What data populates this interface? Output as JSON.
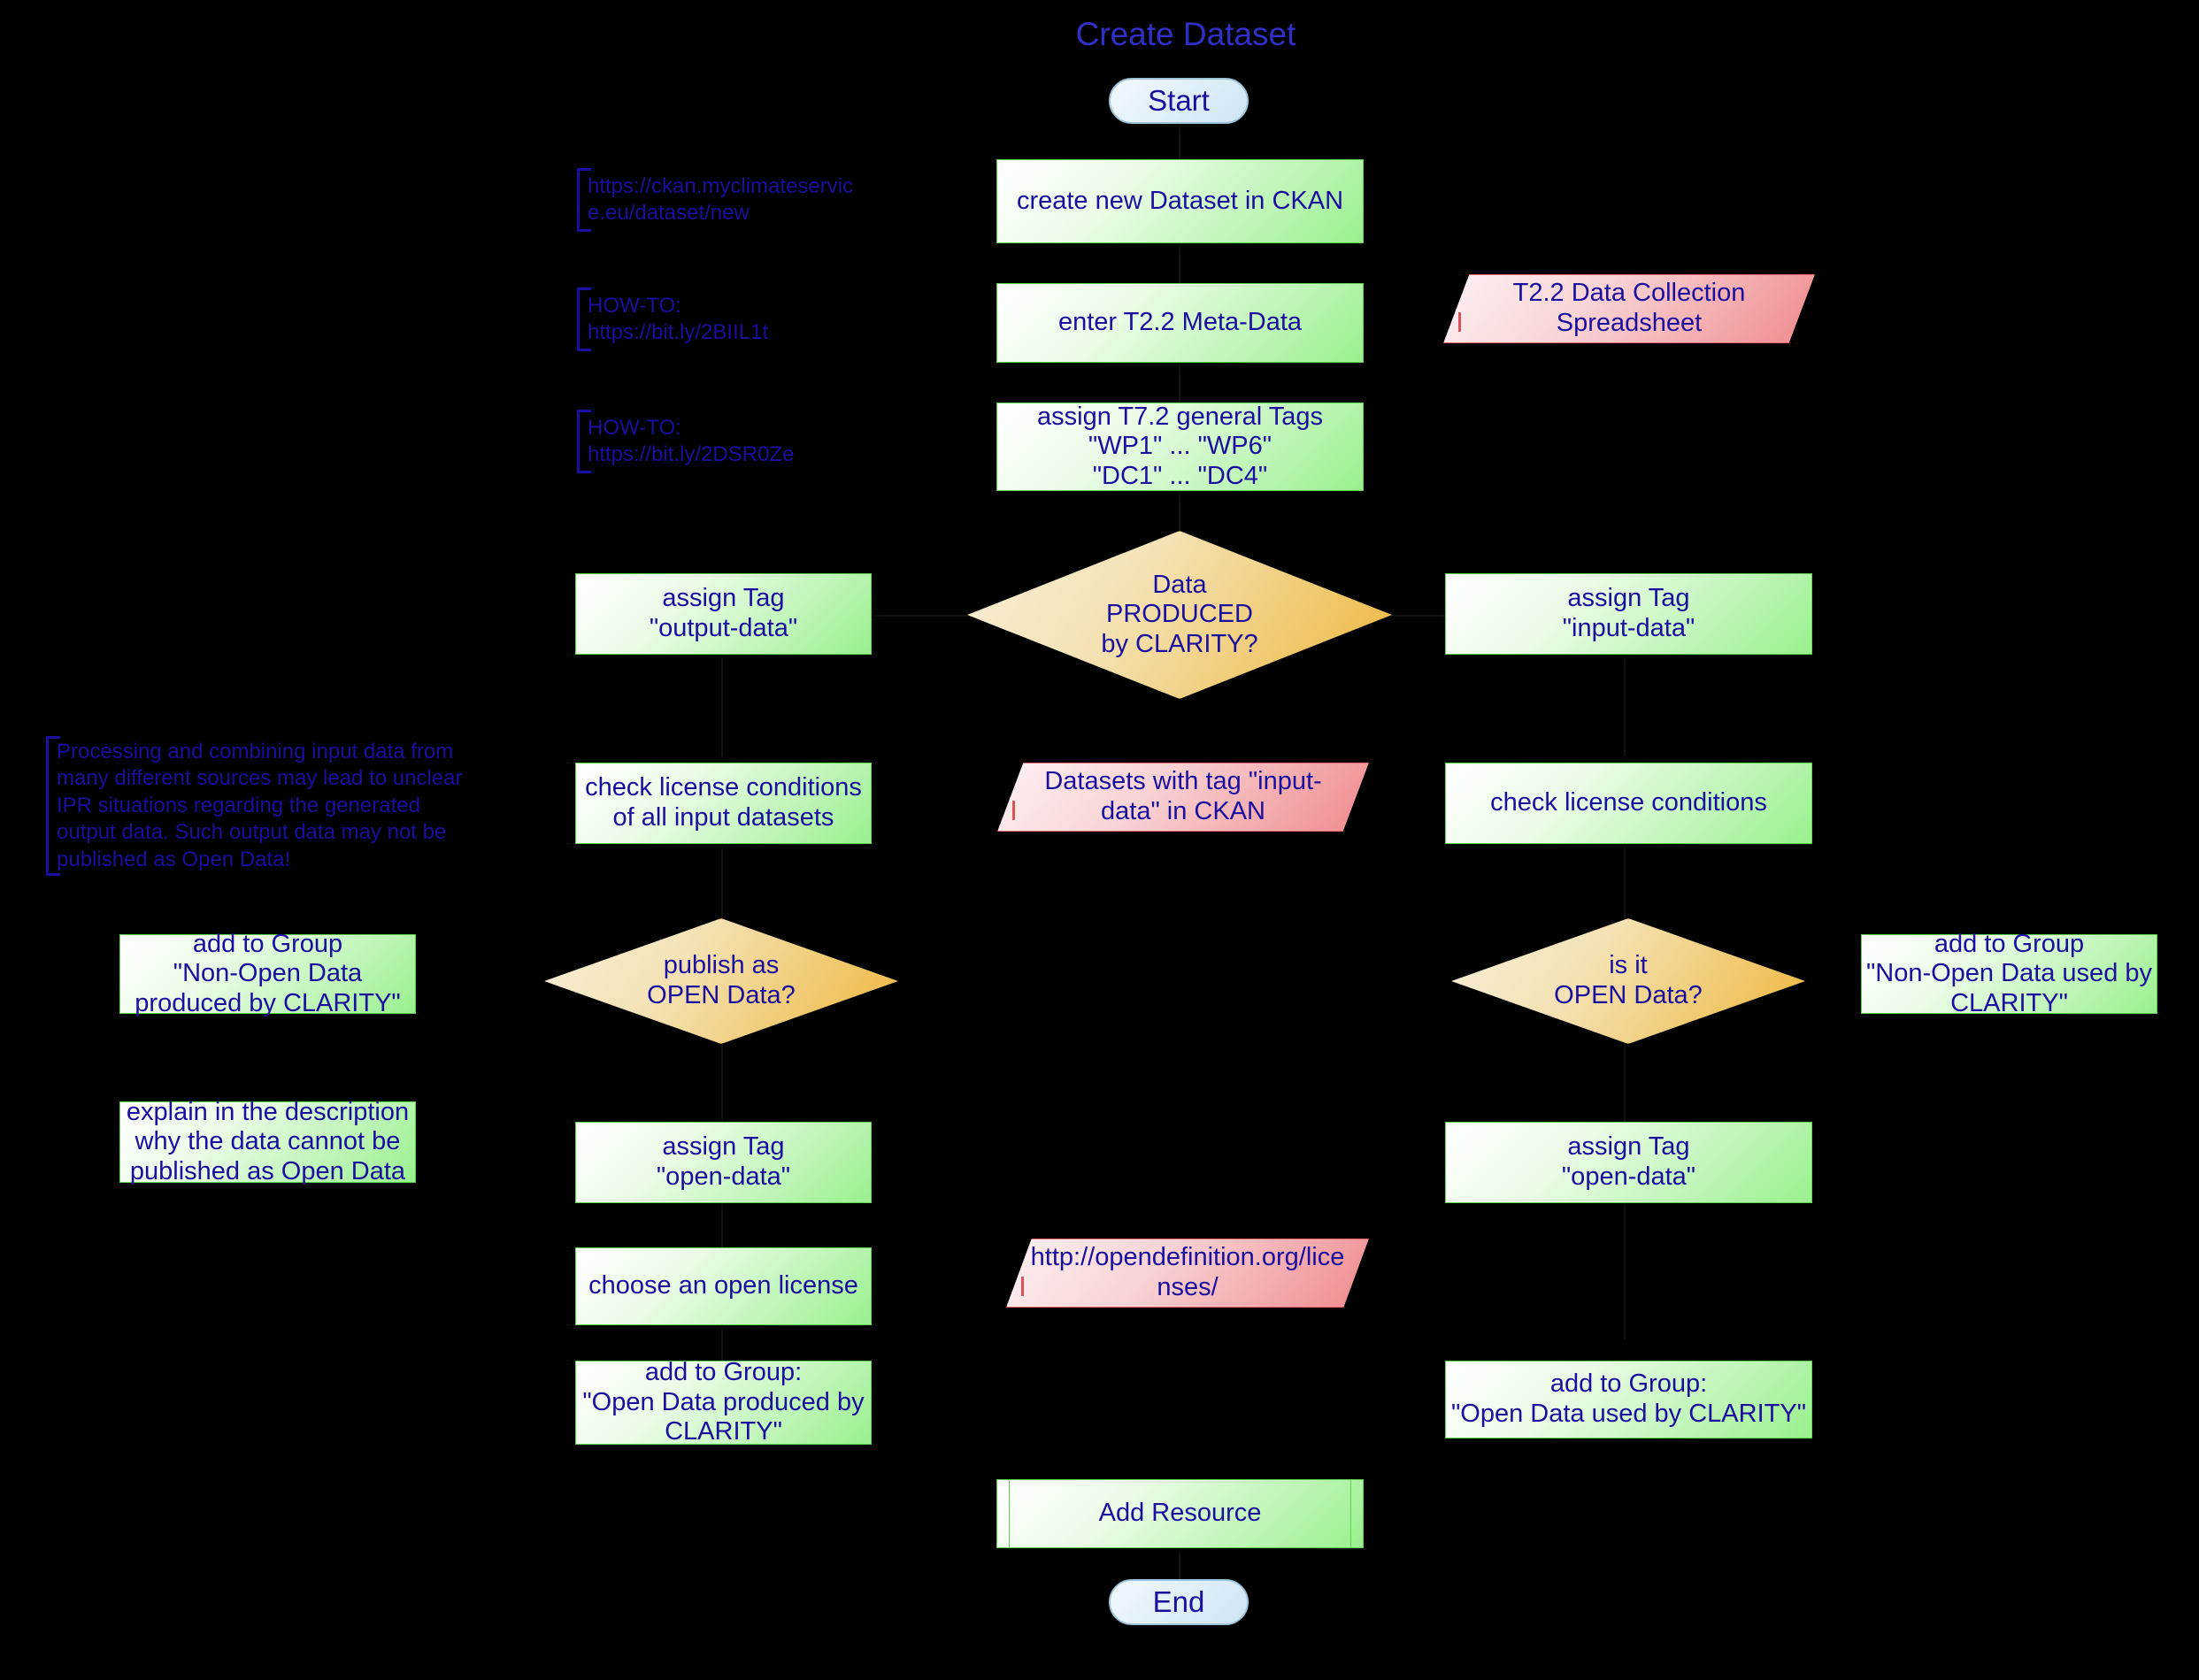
{
  "diagram": {
    "title": "Create Dataset",
    "background_color": "#000000",
    "text_color": "#1a0f9e",
    "title_color": "#3030c8",
    "process_fill": "#9af08f",
    "decision_fill": "#eeb63a",
    "data_fill": "#f08a8e",
    "terminator_fill": "#cfe4f2"
  },
  "nodes": {
    "start": "Start",
    "end": "End",
    "create_dataset": "create new Dataset in CKAN",
    "enter_metadata": "enter T2.2 Meta-Data",
    "assign_general_tags": "assign T7.2 general Tags\n\"WP1\" ... \"WP6\"\n\"DC1\" ... \"DC4\"",
    "decision_produced": "Data\nPRODUCED\nby CLARITY?",
    "assign_output_data": "assign Tag\n\"output-data\"",
    "assign_input_data": "assign Tag\n\"input-data\"",
    "check_license_all_input": "check license conditions\nof all input datasets",
    "check_license": "check license conditions",
    "decision_publish_open": "publish as\nOPEN Data?",
    "decision_is_open": "is it\nOPEN Data?",
    "add_group_nonopen_produced": "add to Group\n\"Non-Open Data\nproduced by CLARITY\"",
    "add_group_nonopen_used": "add to Group\n\"Non-Open Data used by\nCLARITY\"",
    "explain_description": "explain in the description\nwhy the data cannot be\npublished as Open Data",
    "assign_open_data_left": "assign Tag\n\"open-data\"",
    "assign_open_data_right": "assign Tag\n\"open-data\"",
    "choose_open_license": "choose an open license",
    "add_group_open_produced": "add to Group:\n\"Open Data produced by\nCLARITY\"",
    "add_group_open_used": "add to Group:\n\"Open Data used by CLARITY\"",
    "add_resource": "Add Resource"
  },
  "data_shapes": {
    "spreadsheet": "T2.2 Data Collection\nSpreadsheet",
    "datasets_input_tag": "Datasets with tag \"input-\ndata\" in CKAN",
    "opendefinition_link": "http://opendefinition.org/lice\nnses/"
  },
  "annotations": {
    "ckan_new_url": "https://ckan.myclimateservic\ne.eu/dataset/new",
    "howto_metadata": "HOW-TO:\nhttps://bit.ly/2BIIL1t",
    "howto_tags": "HOW-TO:\nhttps://bit.ly/2DSR0Ze",
    "ipr_warning": "Processing and combining input data from\nmany different sources may lead to unclear\nIPR situations regarding the generated\noutput data. Such output data may not be\npublished as Open Data!"
  }
}
